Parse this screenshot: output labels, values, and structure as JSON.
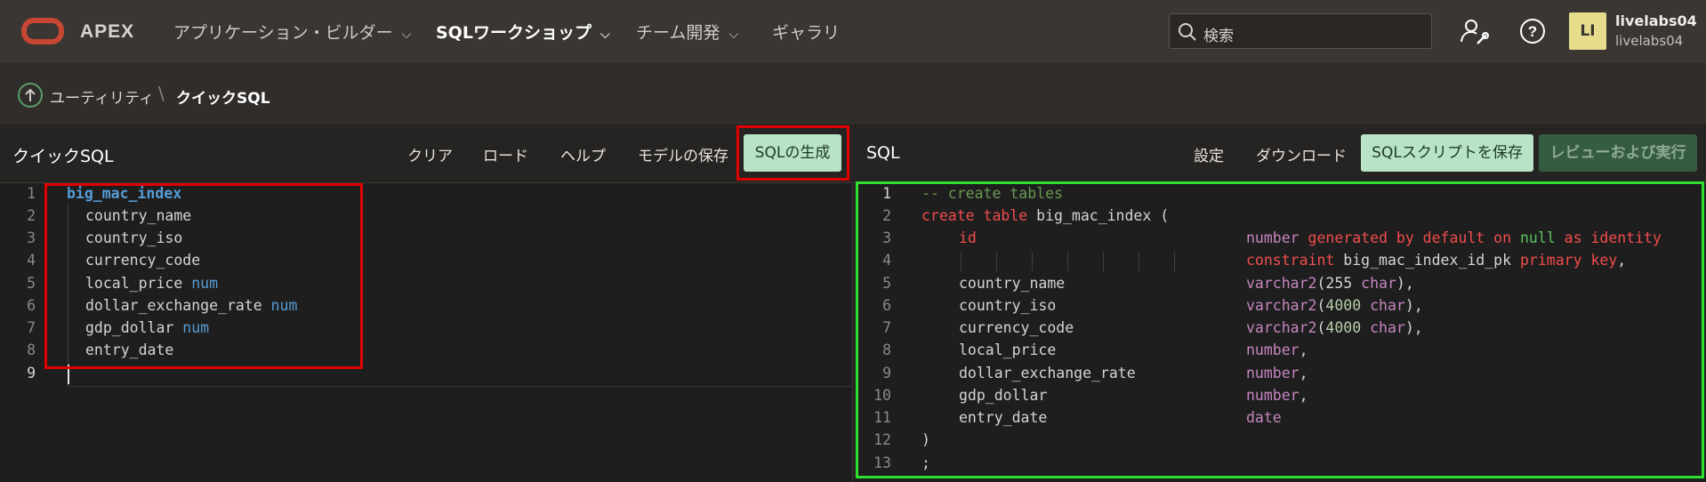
{
  "topbar": {
    "brand": "APEX",
    "nav": [
      {
        "label": "アプリケーション・ビルダー"
      },
      {
        "label": "SQLワークショップ"
      },
      {
        "label": "チーム開発"
      },
      {
        "label": "ギャラリ"
      }
    ],
    "search_placeholder": "検索",
    "user": {
      "initials": "LI",
      "name": "livelabs04",
      "workspace": "livelabs04"
    }
  },
  "breadcrumb": {
    "parent": "ユーティリティ",
    "separator": "\\",
    "current": "クイックSQL"
  },
  "left_panel": {
    "title": "クイックSQL",
    "buttons": {
      "clear": "クリア",
      "load": "ロード",
      "help": "ヘルプ",
      "save_model": "モデルの保存",
      "generate": "SQLの生成"
    },
    "line_numbers": [
      "1",
      "2",
      "3",
      "4",
      "5",
      "6",
      "7",
      "8",
      "9"
    ],
    "lines": [
      {
        "text": "big_mac_index"
      },
      {
        "text": "country_name"
      },
      {
        "text": "country_iso"
      },
      {
        "text": "currency_code"
      },
      {
        "text": "local_price",
        "type": "num"
      },
      {
        "text": "dollar_exchange_rate",
        "type": "num"
      },
      {
        "text": "gdp_dollar",
        "type": "num"
      },
      {
        "text": "entry_date"
      }
    ]
  },
  "right_panel": {
    "title": "SQL",
    "buttons": {
      "settings": "設定",
      "download": "ダウンロード",
      "save_script": "SQLスクリプトを保存",
      "review_run": "レビューおよび実行"
    },
    "line_numbers": [
      "1",
      "2",
      "3",
      "4",
      "5",
      "6",
      "7",
      "8",
      "9",
      "10",
      "11",
      "12",
      "13"
    ],
    "sql": {
      "comment": "-- create tables",
      "create": "create",
      "table": "table",
      "table_name": "big_mac_index (",
      "id_col": "id",
      "id_type": "number",
      "id_gen": "generated by default on",
      "id_null": "null",
      "id_as": "as identity",
      "constraint": "constraint",
      "pk_name": "big_mac_index_id_pk",
      "pk": "primary key",
      "comma": ",",
      "columns": [
        {
          "name": "country_name",
          "type": "varchar2",
          "len": "255",
          "unit": "char"
        },
        {
          "name": "country_iso",
          "type": "varchar2",
          "len": "4000",
          "unit": "char"
        },
        {
          "name": "currency_code",
          "type": "varchar2",
          "len": "4000",
          "unit": "char"
        },
        {
          "name": "local_price",
          "type": "number"
        },
        {
          "name": "dollar_exchange_rate",
          "type": "number"
        },
        {
          "name": "gdp_dollar",
          "type": "number"
        },
        {
          "name": "entry_date",
          "type": "date"
        }
      ],
      "close": ")",
      "end": ";"
    }
  },
  "colors": {
    "highlight_red": "#e00000",
    "highlight_green": "#2ee02e",
    "brand_red": "#c74634",
    "primary_button": "#b8e3c4"
  }
}
